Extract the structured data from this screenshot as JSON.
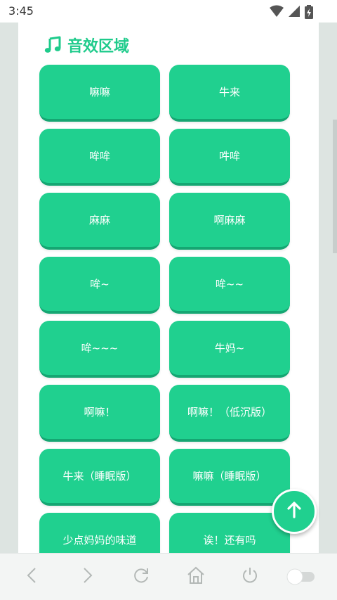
{
  "status_bar": {
    "time": "3:45",
    "icons": [
      "wifi-icon",
      "signal-icon",
      "battery-icon"
    ]
  },
  "section": {
    "title": "音效区域",
    "icon": "music-note-icon"
  },
  "sound_buttons": [
    {
      "label": "嘛嘛"
    },
    {
      "label": "牛来"
    },
    {
      "label": "哞哞"
    },
    {
      "label": "吽哞"
    },
    {
      "label": "麻麻"
    },
    {
      "label": "啊麻麻"
    },
    {
      "label": "哞~"
    },
    {
      "label": "哞~~"
    },
    {
      "label": "哞~~~"
    },
    {
      "label": "牛妈~"
    },
    {
      "label": "啊嘛！"
    },
    {
      "label": "啊嘛！（低沉版）"
    },
    {
      "label": "牛来（睡眠版）"
    },
    {
      "label": "嘛嘛（睡眠版）"
    },
    {
      "label": "少点妈妈的味道"
    },
    {
      "label": "诶！还有吗"
    }
  ],
  "fab": {
    "icon": "arrow-up-icon"
  },
  "bottom_nav": {
    "icons": [
      "back-icon",
      "forward-icon",
      "refresh-icon",
      "home-icon",
      "power-icon",
      "toggle-switch"
    ]
  },
  "colors": {
    "accent": "#20d08f",
    "accent_dark": "#15a672",
    "title": "#1ecb8b"
  }
}
